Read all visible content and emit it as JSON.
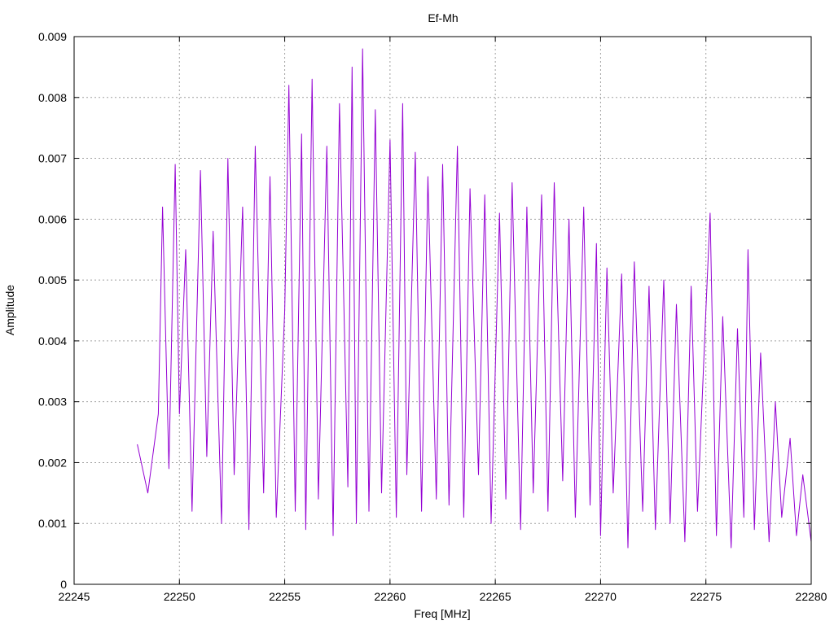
{
  "chart_data": {
    "type": "line",
    "title": "Ef-Mh",
    "xlabel": "Freq [MHz]",
    "ylabel": "Amplitude",
    "xlim": [
      22245,
      22280
    ],
    "ylim": [
      0,
      0.009
    ],
    "xticks": [
      "22245",
      "22250",
      "22255",
      "22260",
      "22265",
      "22270",
      "22275",
      "22280"
    ],
    "yticks": [
      "0",
      "0.001",
      "0.002",
      "0.003",
      "0.004",
      "0.005",
      "0.006",
      "0.007",
      "0.008",
      "0.009"
    ],
    "grid": true,
    "legend": "none",
    "series": [
      {
        "color": "#9400d3",
        "x": [
          22248.0,
          22248.5,
          22249.0,
          22249.2,
          22249.5,
          22249.8,
          22250.0,
          22250.3,
          22250.6,
          22251.0,
          22251.3,
          22251.6,
          22252.0,
          22252.3,
          22252.6,
          22253.0,
          22253.3,
          22253.6,
          22254.0,
          22254.3,
          22254.6,
          22255.0,
          22255.2,
          22255.5,
          22255.8,
          22256.0,
          22256.3,
          22256.6,
          22257.0,
          22257.3,
          22257.6,
          22258.0,
          22258.2,
          22258.4,
          22258.7,
          22259.0,
          22259.3,
          22259.6,
          22260.0,
          22260.3,
          22260.6,
          22260.8,
          22261.2,
          22261.5,
          22261.8,
          22262.2,
          22262.5,
          22262.8,
          22263.2,
          22263.5,
          22263.8,
          22264.2,
          22264.5,
          22264.8,
          22265.2,
          22265.5,
          22265.8,
          22266.2,
          22266.5,
          22266.8,
          22267.2,
          22267.5,
          22267.8,
          22268.2,
          22268.5,
          22268.8,
          22269.2,
          22269.5,
          22269.8,
          22270.0,
          22270.3,
          22270.6,
          22271.0,
          22271.3,
          22271.6,
          22272.0,
          22272.3,
          22272.6,
          22273.0,
          22273.3,
          22273.6,
          22274.0,
          22274.3,
          22274.6,
          22275.0,
          22275.2,
          22275.5,
          22275.8,
          22276.2,
          22276.5,
          22276.8,
          22277.0,
          22277.3,
          22277.6,
          22278.0,
          22278.3,
          22278.6,
          22279.0,
          22279.3,
          22279.6,
          22280.0
        ],
        "y": [
          0.0023,
          0.0015,
          0.0028,
          0.0062,
          0.0019,
          0.0069,
          0.0028,
          0.0055,
          0.0012,
          0.0068,
          0.0021,
          0.0058,
          0.001,
          0.007,
          0.0018,
          0.0062,
          0.0009,
          0.0072,
          0.0015,
          0.0067,
          0.0011,
          0.0045,
          0.0082,
          0.0012,
          0.0074,
          0.0009,
          0.0083,
          0.0014,
          0.0072,
          0.0008,
          0.0079,
          0.0016,
          0.0085,
          0.001,
          0.0088,
          0.0012,
          0.0078,
          0.0015,
          0.0073,
          0.0011,
          0.0079,
          0.0018,
          0.0071,
          0.0012,
          0.0067,
          0.0014,
          0.0069,
          0.0013,
          0.0072,
          0.0011,
          0.0065,
          0.0018,
          0.0064,
          0.001,
          0.0061,
          0.0014,
          0.0066,
          0.0009,
          0.0062,
          0.0015,
          0.0064,
          0.0012,
          0.0066,
          0.0017,
          0.006,
          0.0011,
          0.0062,
          0.0013,
          0.0056,
          0.0008,
          0.0052,
          0.0015,
          0.0051,
          0.0006,
          0.0053,
          0.0012,
          0.0049,
          0.0009,
          0.005,
          0.001,
          0.0046,
          0.0007,
          0.0049,
          0.0012,
          0.0045,
          0.0061,
          0.0008,
          0.0044,
          0.0006,
          0.0042,
          0.0011,
          0.0055,
          0.0009,
          0.0038,
          0.0007,
          0.003,
          0.0011,
          0.0024,
          0.0008,
          0.0018,
          0.0007
        ]
      }
    ]
  }
}
